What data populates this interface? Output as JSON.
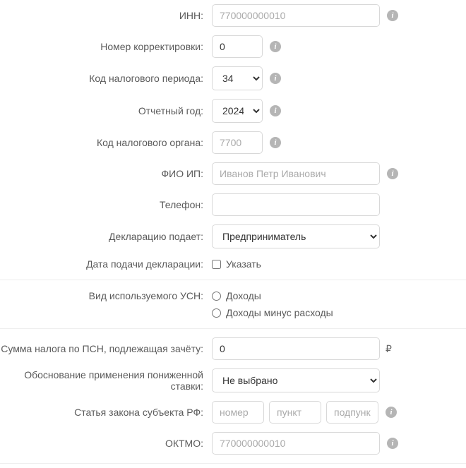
{
  "fields": {
    "inn": {
      "label": "ИНН:",
      "placeholder": "770000000010"
    },
    "corr": {
      "label": "Номер корректировки:",
      "value": "0"
    },
    "period": {
      "label": "Код налогового периода:",
      "value": "34"
    },
    "year": {
      "label": "Отчетный год:",
      "value": "2024"
    },
    "taxorg": {
      "label": "Код налогового органа:",
      "placeholder": "7700"
    },
    "fio": {
      "label": "ФИО ИП:",
      "placeholder": "Иванов Петр Иванович"
    },
    "phone": {
      "label": "Телефон:"
    },
    "submitter": {
      "label": "Декларацию подает:",
      "value": "Предприниматель"
    },
    "submitdate": {
      "label": "Дата подачи декларации:",
      "check_label": "Указать"
    },
    "usn": {
      "label": "Вид используемого УСН:",
      "opt1": "Доходы",
      "opt2": "Доходы минус расходы"
    },
    "psn": {
      "label": "Сумма налога по ПСН, подлежащая зачёту:",
      "value": "0",
      "currency": "₽"
    },
    "basis": {
      "label": "Обоснование применения пониженной ставки:",
      "value": "Не выбрано"
    },
    "statute": {
      "label": "Статья закона субъекта РФ:",
      "p1": "номер",
      "p2": "пункт",
      "p3": "подпункт"
    },
    "oktmo": {
      "label": "ОКТМО:",
      "placeholder": "770000000010"
    }
  }
}
